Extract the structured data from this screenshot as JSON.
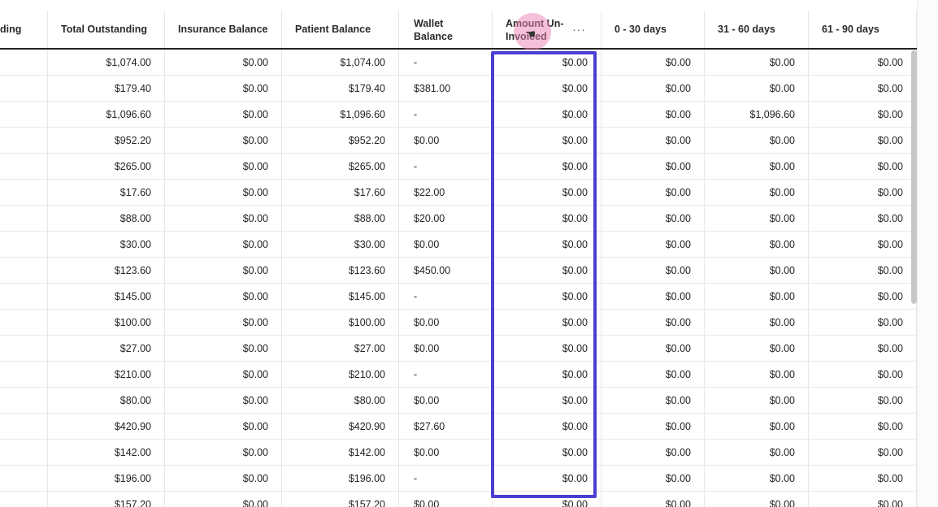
{
  "table": {
    "columns": [
      {
        "key": "c0",
        "label": "ding",
        "width": 59,
        "align": "r",
        "first": true
      },
      {
        "key": "total_outstanding",
        "label": "Total Outstanding",
        "width": 144,
        "align": "r"
      },
      {
        "key": "insurance_balance",
        "label": "Insurance Balance",
        "width": 144,
        "align": "r"
      },
      {
        "key": "patient_balance",
        "label": "Patient Balance",
        "width": 144,
        "align": "r"
      },
      {
        "key": "wallet_balance",
        "label": "Wallet Balance",
        "width": 115,
        "align": "l",
        "top": true
      },
      {
        "key": "amount_uninvoiced",
        "label": "Amount Un-Invoiced",
        "width": 134,
        "align": "r",
        "top": true,
        "more": "···"
      },
      {
        "key": "d0_30",
        "label": "0 - 30 days",
        "width": 127,
        "align": "r"
      },
      {
        "key": "d31_60",
        "label": "31 - 60 days",
        "width": 128,
        "align": "r"
      },
      {
        "key": "d61_90",
        "label": "61 - 90 days",
        "width": 133,
        "align": "r"
      }
    ],
    "rows": [
      [
        "",
        "$1,074.00",
        "$0.00",
        "$1,074.00",
        "-",
        "$0.00",
        "$0.00",
        "$0.00",
        "$0.00"
      ],
      [
        "",
        "$179.40",
        "$0.00",
        "$179.40",
        "$381.00",
        "$0.00",
        "$0.00",
        "$0.00",
        "$0.00"
      ],
      [
        "",
        "$1,096.60",
        "$0.00",
        "$1,096.60",
        "-",
        "$0.00",
        "$0.00",
        "$1,096.60",
        "$0.00"
      ],
      [
        "",
        "$952.20",
        "$0.00",
        "$952.20",
        "$0.00",
        "$0.00",
        "$0.00",
        "$0.00",
        "$0.00"
      ],
      [
        "",
        "$265.00",
        "$0.00",
        "$265.00",
        "-",
        "$0.00",
        "$0.00",
        "$0.00",
        "$0.00"
      ],
      [
        "",
        "$17.60",
        "$0.00",
        "$17.60",
        "$22.00",
        "$0.00",
        "$0.00",
        "$0.00",
        "$0.00"
      ],
      [
        "",
        "$88.00",
        "$0.00",
        "$88.00",
        "$20.00",
        "$0.00",
        "$0.00",
        "$0.00",
        "$0.00"
      ],
      [
        "",
        "$30.00",
        "$0.00",
        "$30.00",
        "$0.00",
        "$0.00",
        "$0.00",
        "$0.00",
        "$0.00"
      ],
      [
        "",
        "$123.60",
        "$0.00",
        "$123.60",
        "$450.00",
        "$0.00",
        "$0.00",
        "$0.00",
        "$0.00"
      ],
      [
        "",
        "$145.00",
        "$0.00",
        "$145.00",
        "-",
        "$0.00",
        "$0.00",
        "$0.00",
        "$0.00"
      ],
      [
        "",
        "$100.00",
        "$0.00",
        "$100.00",
        "$0.00",
        "$0.00",
        "$0.00",
        "$0.00",
        "$0.00"
      ],
      [
        "",
        "$27.00",
        "$0.00",
        "$27.00",
        "$0.00",
        "$0.00",
        "$0.00",
        "$0.00",
        "$0.00"
      ],
      [
        "",
        "$210.00",
        "$0.00",
        "$210.00",
        "-",
        "$0.00",
        "$0.00",
        "$0.00",
        "$0.00"
      ],
      [
        "",
        "$80.00",
        "$0.00",
        "$80.00",
        "$0.00",
        "$0.00",
        "$0.00",
        "$0.00",
        "$0.00"
      ],
      [
        "",
        "$420.90",
        "$0.00",
        "$420.90",
        "$27.60",
        "$0.00",
        "$0.00",
        "$0.00",
        "$0.00"
      ],
      [
        "",
        "$142.00",
        "$0.00",
        "$142.00",
        "$0.00",
        "$0.00",
        "$0.00",
        "$0.00",
        "$0.00"
      ],
      [
        "",
        "$196.00",
        "$0.00",
        "$196.00",
        "-",
        "$0.00",
        "$0.00",
        "$0.00",
        "$0.00"
      ],
      [
        "",
        "$157.20",
        "$0.00",
        "$157.20",
        "$0.00",
        "$0.00",
        "$0.00",
        "$0.00",
        "$0.00"
      ]
    ]
  },
  "colors": {
    "highlight_border": "#4a3fd1",
    "cursor_halo": "#ec82b4",
    "header_rule": "#222222"
  },
  "icons": {
    "column_menu": "more-horizontal-icon",
    "cursor": "hand-pointer-icon"
  }
}
